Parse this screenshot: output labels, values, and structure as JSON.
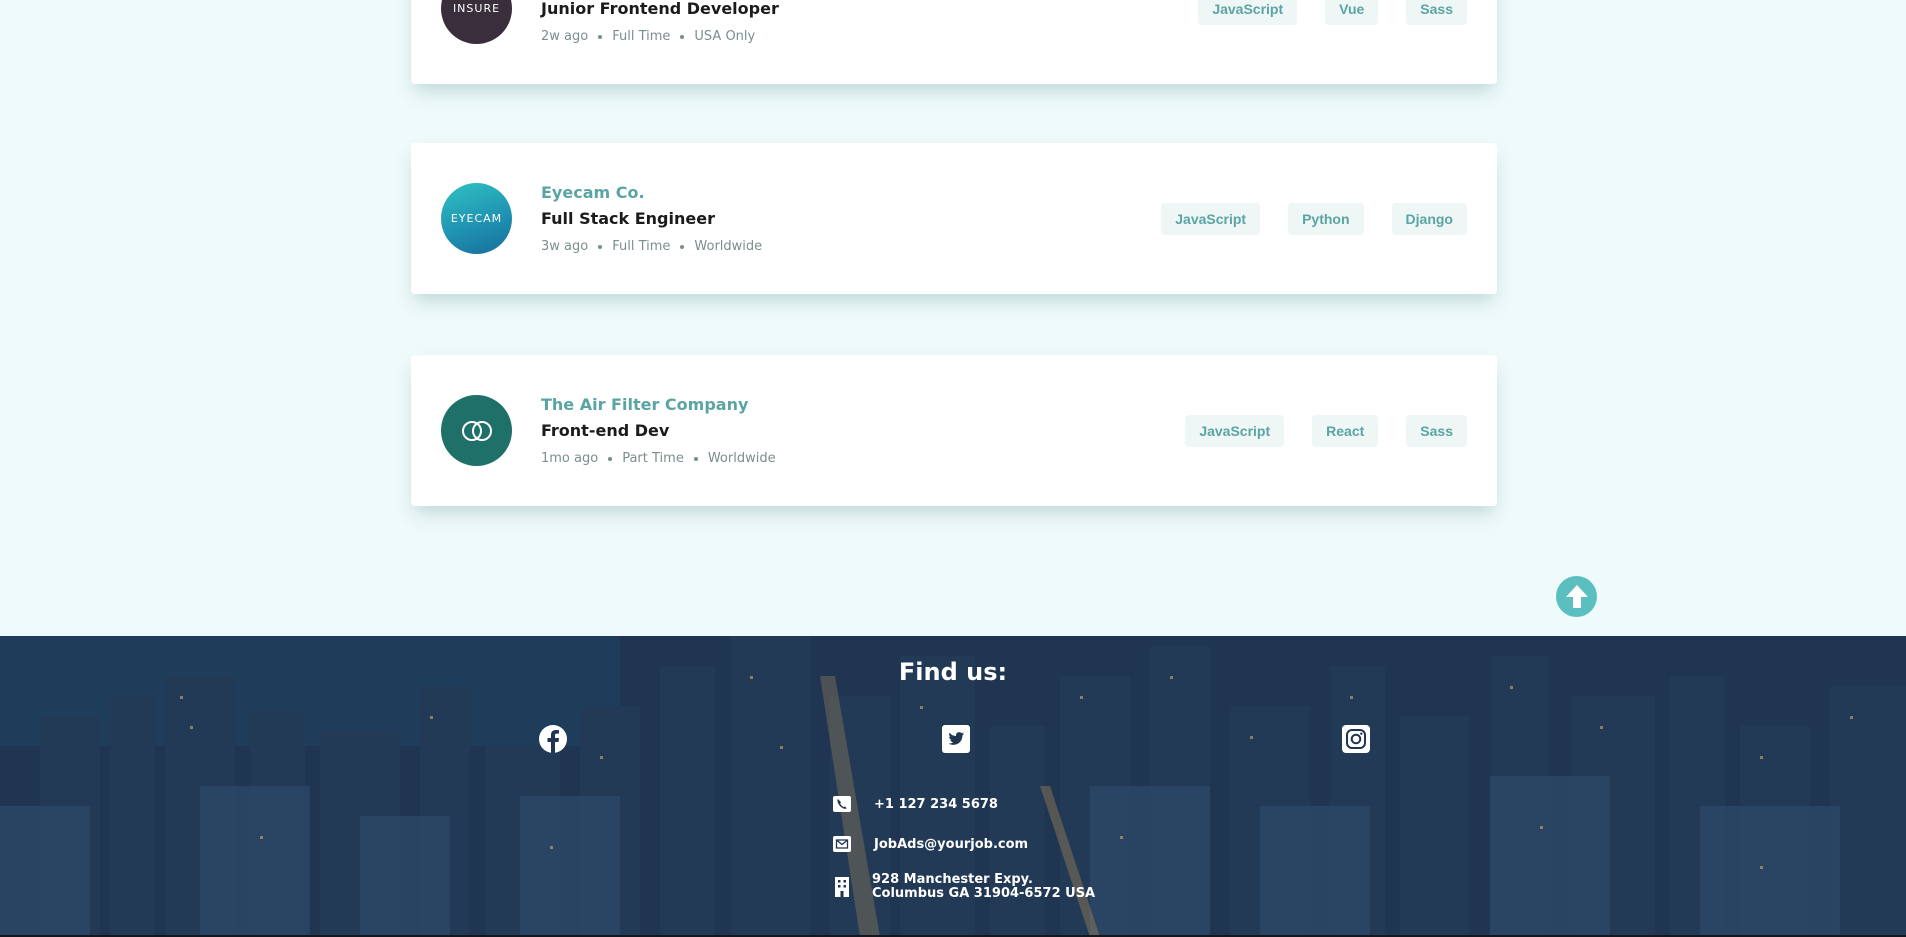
{
  "jobs": [
    {
      "company": "",
      "logo_text": "INSURE",
      "logo_color": "#3a2e3c",
      "position": "Junior Frontend Developer",
      "posted": "2w ago",
      "contract": "Full Time",
      "location": "USA Only",
      "tags": [
        "JavaScript",
        "Vue",
        "Sass"
      ]
    },
    {
      "company": "Eyecam Co.",
      "logo_text": "EYECAM",
      "logo_color": "#25a3b5",
      "position": "Full Stack Engineer",
      "posted": "3w ago",
      "contract": "Full Time",
      "location": "Worldwide",
      "tags": [
        "JavaScript",
        "Python",
        "Django"
      ]
    },
    {
      "company": "The Air Filter Company",
      "logo_text": "",
      "logo_color": "#1e7068",
      "position": "Front-end Dev",
      "posted": "1mo ago",
      "contract": "Part Time",
      "location": "Worldwide",
      "tags": [
        "JavaScript",
        "React",
        "Sass"
      ]
    }
  ],
  "scroll_top_icon": "arrow-up-circle-icon",
  "footer": {
    "title": "Find us:",
    "social_icons": [
      "facebook-icon",
      "twitter-icon",
      "instagram-icon"
    ],
    "phone": "+1 127 234 5678",
    "email": "JobAds@yourjob.com",
    "address_line1": "928 Manchester Expy.",
    "address_line2": "Columbus GA 31904-6572 USA"
  },
  "colors": {
    "background": "#effafa",
    "accent": "#5ba4a4",
    "tag_bg": "#eef6f6",
    "scroll_button": "#5bbfc0"
  }
}
